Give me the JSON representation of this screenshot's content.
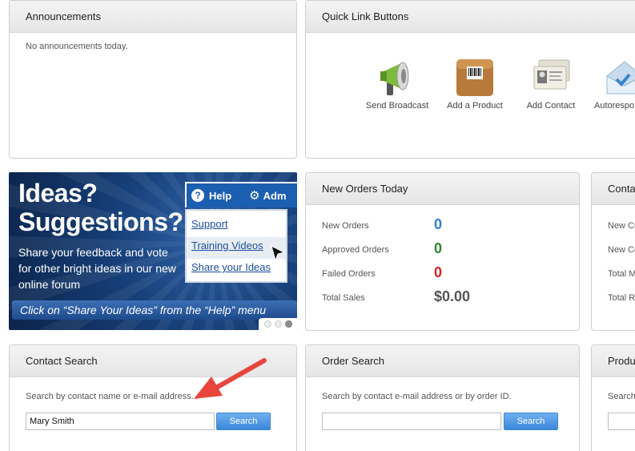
{
  "announcements": {
    "title": "Announcements",
    "message": "No announcements today."
  },
  "quick_links": {
    "title": "Quick Link Buttons",
    "items": [
      {
        "label": "Send Broadcast",
        "icon": "megaphone-icon"
      },
      {
        "label": "Add a Product",
        "icon": "product-box-icon"
      },
      {
        "label": "Add Contact",
        "icon": "contact-card-icon"
      },
      {
        "label": "Autorespo",
        "icon": "autoresponder-envelope-icon"
      }
    ]
  },
  "promo": {
    "title_line1": "Ideas?",
    "title_line2": "Suggestions?",
    "body": "Share your feedback and vote for other bright ideas in our new online forum",
    "menu_help": "Help",
    "menu_admin": "Adm",
    "menu_items": [
      "Support",
      "Training Videos",
      "Share your Ideas"
    ],
    "footer": "Click on “Share Your Ideas” from the “Help” menu"
  },
  "orders_today": {
    "title": "New Orders Today",
    "rows": [
      {
        "label": "New Orders",
        "value": "0",
        "color": "#2f7fd6"
      },
      {
        "label": "Approved Orders",
        "value": "0",
        "color": "#2a8a2a"
      },
      {
        "label": "Failed Orders",
        "value": "0",
        "color": "#d2232a"
      },
      {
        "label": "Total Sales",
        "value": "$0.00",
        "color": "#555555"
      }
    ]
  },
  "contact_stats": {
    "title": "Conta",
    "rows": [
      "New Cu",
      "New Co",
      "Total M",
      "Total Re"
    ]
  },
  "contact_search": {
    "title": "Contact Search",
    "hint": "Search by contact name or e-mail address.",
    "value": "Mary Smith",
    "button": "Search"
  },
  "order_search": {
    "title": "Order Search",
    "hint": "Search by contact e-mail address or by order ID.",
    "value": "",
    "button": "Search"
  },
  "product_search": {
    "title": "Produ",
    "hint": "Search"
  }
}
